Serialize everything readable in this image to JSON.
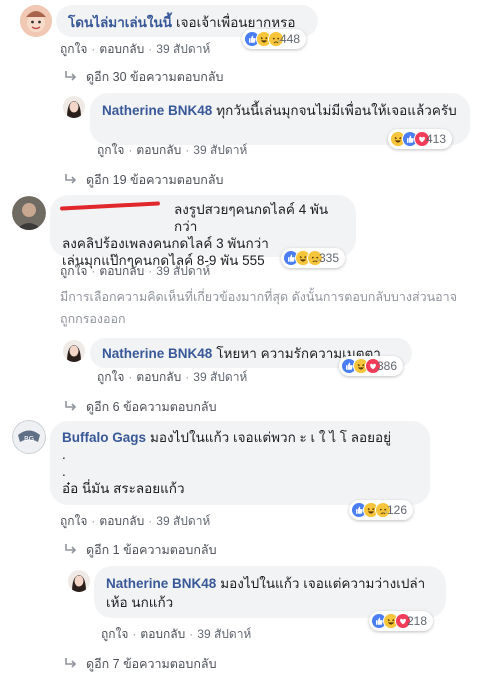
{
  "colors": {
    "link": "#385898",
    "bubble": "#f2f3f5",
    "like": "#4a7ef2",
    "love": "#f23c5a",
    "haha": "#f7c53c"
  },
  "comments": [
    {
      "author": "โดนไล่มาเล่นในนี้",
      "text": "เจอเจ้าเพื่อนยากหรอ",
      "actions": {
        "like": "ถูกใจ",
        "reply": "ตอบกลับ",
        "time": "39 สัปดาห์"
      },
      "reaction_icons": [
        "like-icon",
        "haha-icon",
        "sad-icon"
      ],
      "reaction_count": "448",
      "replies_link": "ดูอีก 30 ข้อความตอบกลับ"
    },
    {
      "author": "Natherine BNK48",
      "text": "ทุกวันนี้เล่นมุกจนไม่มีเพื่อนให้เจอแล้วครับ",
      "actions": {
        "like": "ถูกใจ",
        "reply": "ตอบกลับ",
        "time": "39 สัปดาห์"
      },
      "reaction_icons": [
        "haha-icon",
        "like-icon",
        "love-icon"
      ],
      "reaction_count": "413",
      "replies_link": "ดูอีก 19 ข้อความตอบกลับ"
    },
    {
      "author": "",
      "text_lines": [
        "ลงรูปสวยๆคนกดไลค์ 4 พันกว่า",
        "ลงคลิปร้องเพลงคนกดไลค์ 3 พันกว่า",
        "เล่นมุกแป๊กๆคนกดไลค์ 8-9 พัน 555"
      ],
      "actions": {
        "like": "ถูกใจ",
        "reply": "ตอบกลับ",
        "time": "39 สัปดาห์"
      },
      "reaction_icons": [
        "like-icon",
        "haha-icon",
        "sad-icon"
      ],
      "reaction_count": "335",
      "note": "มีการเลือกความคิดเห็นที่เกี่ยวข้องมากที่สุด ดังนั้นการตอบกลับบางส่วนอาจถูกกรองออก"
    },
    {
      "author": "Natherine BNK48",
      "text": "โหยหา ความรักความเมตตา...",
      "actions": {
        "like": "ถูกใจ",
        "reply": "ตอบกลับ",
        "time": "39 สัปดาห์"
      },
      "reaction_icons": [
        "like-icon",
        "haha-icon",
        "love-icon"
      ],
      "reaction_count": "386",
      "replies_link": "ดูอีก 6 ข้อความตอบกลับ"
    },
    {
      "author": "Buffalo Gags",
      "text": "มองไปในแก้ว เจอแต่พวก ะ เ ใ ไ โ ลอยอยู่",
      "text_lines": [
        ".",
        ".",
        "อ๋อ นี่มัน สระลอยแก้ว"
      ],
      "actions": {
        "like": "ถูกใจ",
        "reply": "ตอบกลับ",
        "time": "39 สัปดาห์"
      },
      "reaction_icons": [
        "like-icon",
        "haha-icon",
        "sad-icon"
      ],
      "reaction_count": "126",
      "replies_link": "ดูอีก 1 ข้อความตอบกลับ"
    },
    {
      "author": "Natherine BNK48",
      "text": "มองไปในแก้ว เจอแต่ความว่างเปล่า",
      "text_line2": "เห้อ นกแก้ว",
      "actions": {
        "like": "ถูกใจ",
        "reply": "ตอบกลับ",
        "time": "39 สัปดาห์"
      },
      "reaction_icons": [
        "like-icon",
        "haha-icon",
        "love-icon"
      ],
      "reaction_count": "218",
      "replies_link": "ดูอีก 7 ข้อความตอบกลับ"
    }
  ]
}
